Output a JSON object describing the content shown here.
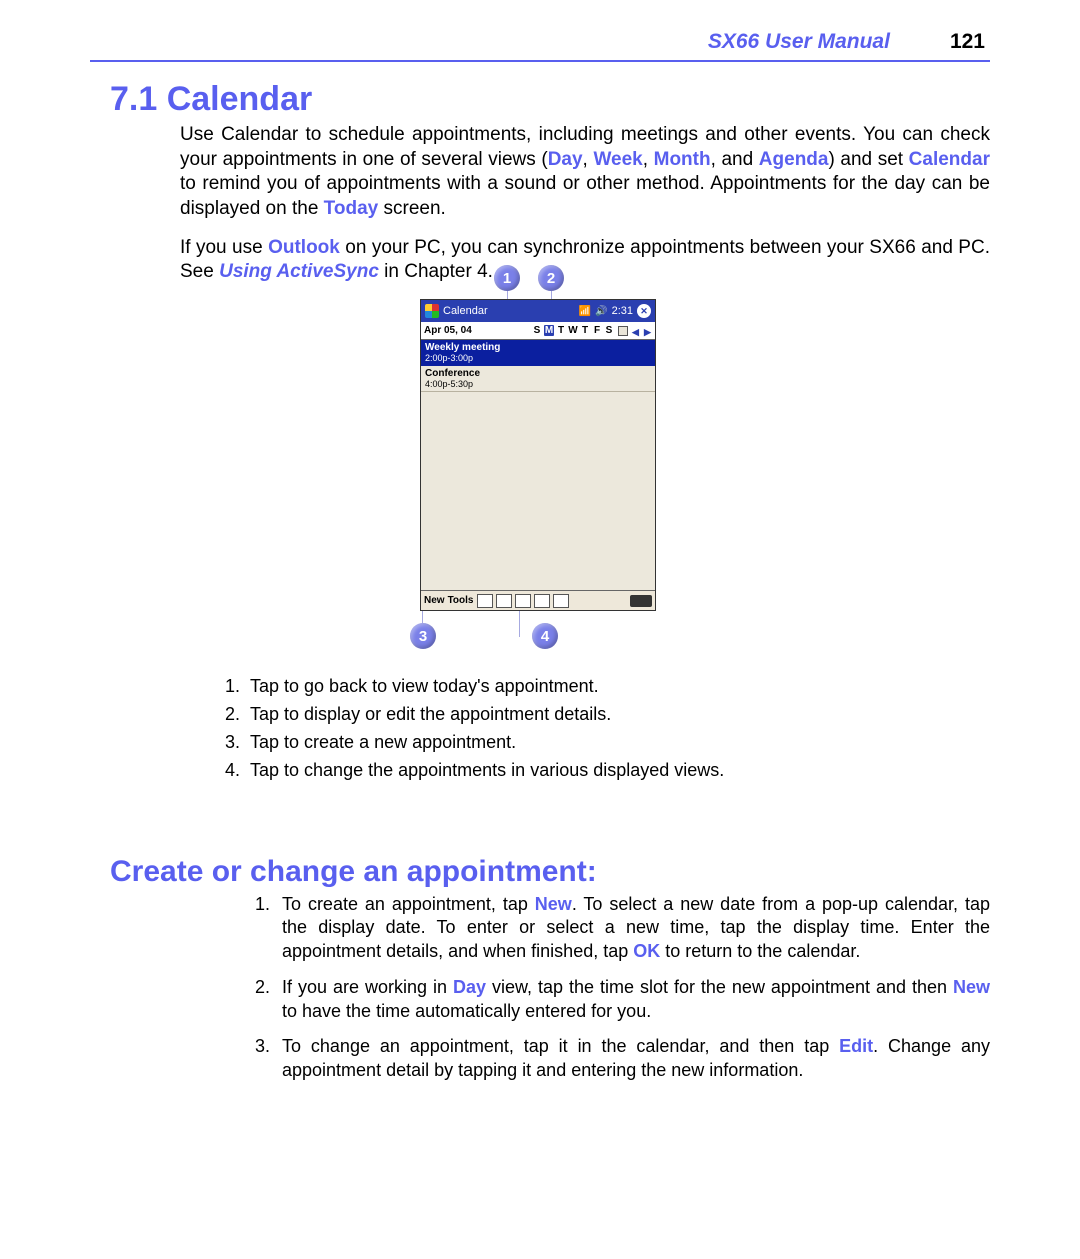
{
  "header": {
    "manual_title": "SX66 User Manual",
    "page_number": "121"
  },
  "section": {
    "number": "7.1",
    "title": "Calendar",
    "intro_prefix": "Use Calendar to schedule appointments, including meetings and other events. You can check your appointments in one of several views (",
    "kw_day": "Day",
    "comma1": ", ",
    "kw_week": "Week",
    "comma2": ", ",
    "kw_month": "Month",
    "and": ", and ",
    "kw_agenda": "Agenda",
    "intro_mid": ") and set ",
    "kw_calendar": "Calendar",
    "intro_mid2": " to remind you of appointments with a sound or other method. Appointments for the day can be displayed on the ",
    "kw_today": "Today",
    "intro_end": " screen.",
    "para2_pre": "If you use ",
    "kw_outlook": "Outlook",
    "para2_mid": " on your PC, you can synchronize appointments between your SX66 and PC. See ",
    "kw_activesync": "Using ActiveSync",
    "para2_end": " in Chapter 4."
  },
  "bubbles": {
    "b1": "1",
    "b2": "2",
    "b3": "3",
    "b4": "4"
  },
  "device": {
    "app_title": "Calendar",
    "clock": "2:31",
    "date_label": "Apr 05, 04",
    "dow": [
      "S",
      "M",
      "T",
      "W",
      "T",
      "F",
      "S"
    ],
    "dow_selected_index": 1,
    "appt1_name": "Weekly meeting",
    "appt1_time": "2:00p-3:00p",
    "appt2_name": "Conference",
    "appt2_time": "4:00p-5:30p",
    "toolbar_new": "New",
    "toolbar_tools": "Tools"
  },
  "callouts": {
    "c1": "Tap to go back to view today's appointment.",
    "c2": "Tap to display or edit the appointment details.",
    "c3": "Tap to create a new appointment.",
    "c4": "Tap to change the appointments in various displayed views."
  },
  "sub": {
    "heading": "Create or change an appointment:",
    "s1_pre": "To create an appointment, tap ",
    "s1_kw1": "New",
    "s1_mid": ". To select a new date from a pop-up calendar, tap the display date. To enter or select a new time, tap the display time. Enter the appointment details, and when finished, tap ",
    "s1_kw2": "OK",
    "s1_end": " to return to the calendar.",
    "s2_pre": "If you are working in ",
    "s2_kw1": "Day",
    "s2_mid": " view, tap the time slot for the new appointment and then ",
    "s2_kw2": "New",
    "s2_end": " to have the time automatically entered for you.",
    "s3_pre": "To change an appointment, tap it in the calendar, and then tap ",
    "s3_kw1": "Edit",
    "s3_end": ". Change any appointment detail by tapping it and entering the new information."
  }
}
